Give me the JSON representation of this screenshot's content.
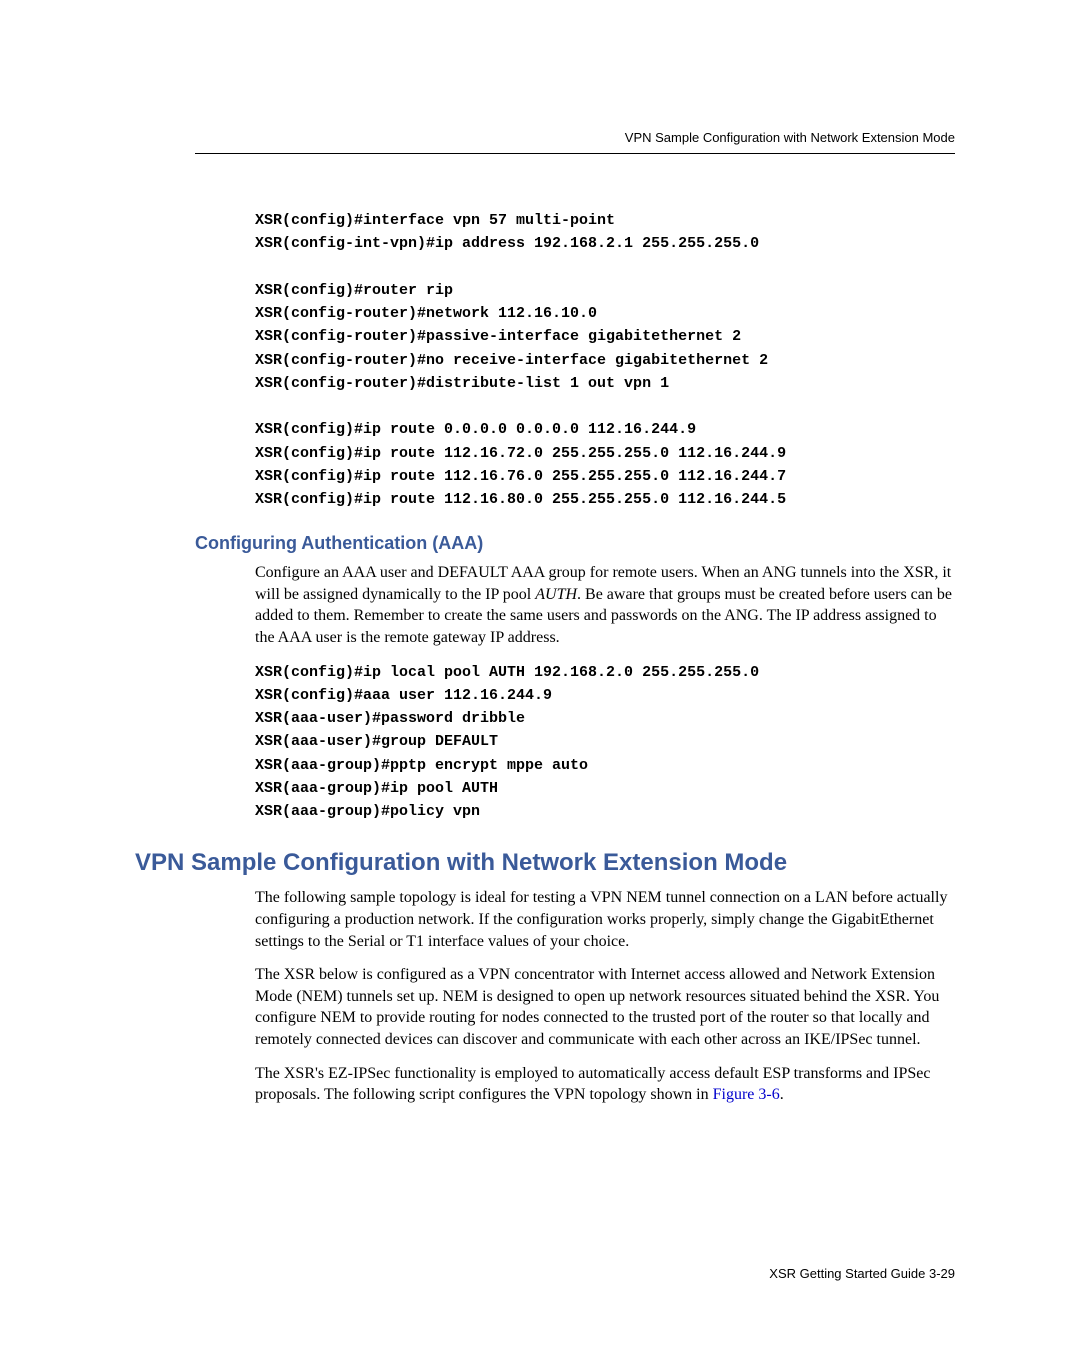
{
  "runningHead": "VPN Sample Configuration with Network Extension Mode",
  "codeBlock1": "XSR(config)#interface vpn 57 multi-point\nXSR(config-int-vpn)#ip address 192.168.2.1 255.255.255.0\n\nXSR(config)#router rip\nXSR(config-router)#network 112.16.10.0\nXSR(config-router)#passive-interface gigabitethernet 2\nXSR(config-router)#no receive-interface gigabitethernet 2\nXSR(config-router)#distribute-list 1 out vpn 1\n\nXSR(config)#ip route 0.0.0.0 0.0.0.0 112.16.244.9\nXSR(config)#ip route 112.16.72.0 255.255.255.0 112.16.244.9\nXSR(config)#ip route 112.16.76.0 255.255.255.0 112.16.244.7\nXSR(config)#ip route 112.16.80.0 255.255.255.0 112.16.244.5",
  "subHeading": "Configuring Authentication (AAA)",
  "para1a": "Configure an AAA user and DEFAULT AAA group for remote users. When an ANG tunnels into the XSR, it will be assigned dynamically to the IP pool ",
  "para1Italic": "AUTH",
  "para1b": ". Be aware that groups must be created before users can be added to them. Remember to create the same users and passwords on the ANG. The IP address assigned to the AAA user is the remote gateway IP address.",
  "codeBlock2": "XSR(config)#ip local pool AUTH 192.168.2.0 255.255.255.0\nXSR(config)#aaa user 112.16.244.9\nXSR(aaa-user)#password dribble\nXSR(aaa-user)#group DEFAULT\nXSR(aaa-group)#pptp encrypt mppe auto\nXSR(aaa-group)#ip pool AUTH\nXSR(aaa-group)#policy vpn",
  "sectionHeading": "VPN Sample Configuration with Network Extension Mode",
  "para2": "The following sample topology is ideal for testing a VPN NEM tunnel connection on a LAN before actually configuring a production network. If the configuration works properly, simply change the GigabitEthernet settings to the Serial or T1 interface values of your choice.",
  "para3": "The XSR below is configured as a VPN concentrator with Internet access allowed and Network Extension Mode (NEM) tunnels set up. NEM is designed to open up network resources situated behind the XSR. You configure NEM to provide routing for nodes connected to the trusted port of the router so that locally and remotely connected devices can discover and communicate with each other across an IKE/IPSec tunnel.",
  "para4a": "The XSR's EZ-IPSec functionality is employed to automatically access default ESP transforms and IPSec proposals. The following script configures the VPN topology shown in ",
  "figLink": "Figure 3-6",
  "para4b": ".",
  "footer": "XSR Getting Started Guide   3-29"
}
